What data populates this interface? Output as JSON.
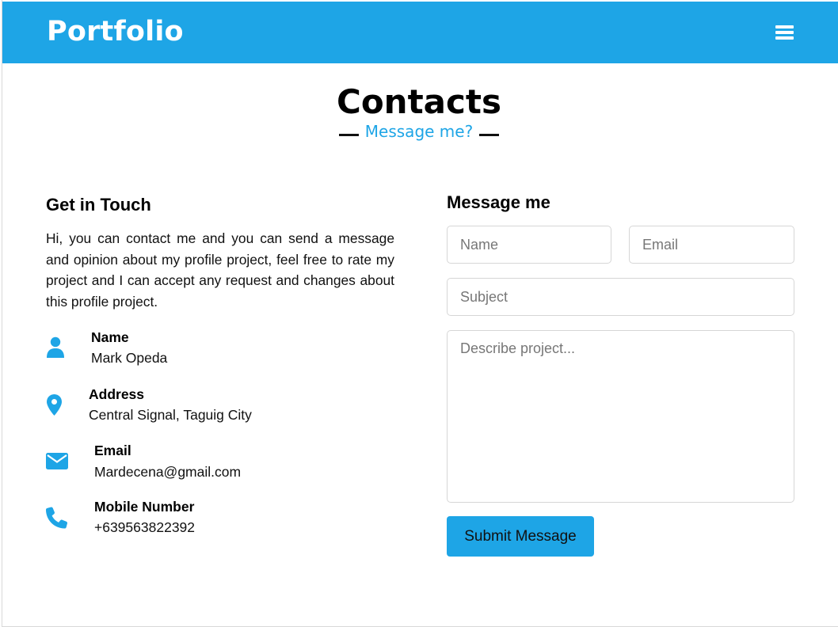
{
  "header": {
    "brand": "Portfolio",
    "menu_icon": "hamburger-menu-icon"
  },
  "section": {
    "title": "Contacts",
    "subtitle": "Message me?"
  },
  "contact_info": {
    "heading": "Get in Touch",
    "intro": "Hi, you can contact me and you can send a message and opinion about my profile project, feel free to rate my project and I can accept any request and changes about this profile project.",
    "items": [
      {
        "icon": "person-icon",
        "label": "Name",
        "value": "Mark Opeda"
      },
      {
        "icon": "location-pin-icon",
        "label": "Address",
        "value": "Central Signal, Taguig City"
      },
      {
        "icon": "envelope-icon",
        "label": "Email",
        "value": "Mardecena@gmail.com"
      },
      {
        "icon": "phone-icon",
        "label": "Mobile Number",
        "value": "+639563822392"
      }
    ]
  },
  "form": {
    "heading": "Message me",
    "name_placeholder": "Name",
    "email_placeholder": "Email",
    "subject_placeholder": "Subject",
    "message_placeholder": "Describe project...",
    "submit_label": "Submit Message"
  },
  "colors": {
    "accent": "#1ea5e6",
    "text": "#111111",
    "border": "#d6d6d6"
  }
}
